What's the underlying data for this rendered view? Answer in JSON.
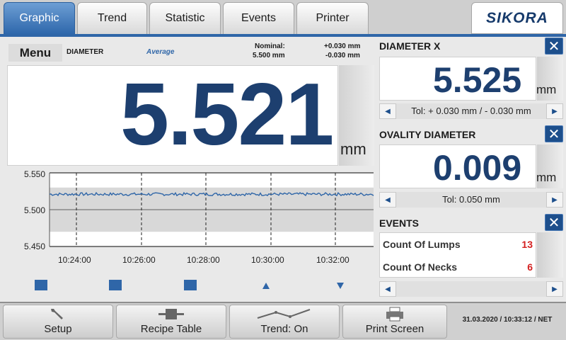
{
  "tabs": [
    {
      "label": "Graphic",
      "active": true
    },
    {
      "label": "Trend",
      "active": false
    },
    {
      "label": "Statistic",
      "active": false
    },
    {
      "label": "Events",
      "active": false
    },
    {
      "label": "Printer",
      "active": false
    }
  ],
  "brand": "SIKORA",
  "left": {
    "menu_label": "Menu",
    "measure_label": "DIAMETER",
    "mode_label": "Average",
    "nominal_label": "Nominal:",
    "nominal_value": "5.500 mm",
    "tol_plus": "+0.030 mm",
    "tol_minus": "-0.030 mm",
    "main_value": "5.521",
    "main_unit": "mm"
  },
  "chart_data": {
    "type": "line",
    "y_ticks": [
      "5.550",
      "5.500",
      "5.450"
    ],
    "ylim": [
      5.45,
      5.55
    ],
    "x_ticks": [
      "10:24:00",
      "10:26:00",
      "10:28:00",
      "10:30:00",
      "10:32:00"
    ],
    "tolerance_band": [
      5.47,
      5.53
    ],
    "nominal": 5.5,
    "series": [
      {
        "values_mean": 5.521
      }
    ],
    "colors": {
      "line": "#2f66a8",
      "band": "#d8d8d8"
    }
  },
  "right": {
    "diameter_x": {
      "title": "DIAMETER X",
      "value": "5.525",
      "unit": "mm",
      "tol": "Tol: + 0.030 mm / - 0.030 mm"
    },
    "ovality": {
      "title": "OVALITY DIAMETER",
      "value": "0.009",
      "unit": "mm",
      "tol": "Tol: 0.050 mm"
    },
    "events": {
      "title": "EVENTS",
      "rows": [
        {
          "label": "Count Of Lumps",
          "count": "13"
        },
        {
          "label": "Count Of Necks",
          "count": "6"
        }
      ]
    },
    "close_glyph": "✕",
    "left_arrow": "◀",
    "right_arrow": "▶"
  },
  "bottom": {
    "setup": "Setup",
    "recipe": "Recipe Table",
    "trend": "Trend: On",
    "print": "Print Screen",
    "datetime": "31.03.2020 / 10:33:12 / NET"
  }
}
